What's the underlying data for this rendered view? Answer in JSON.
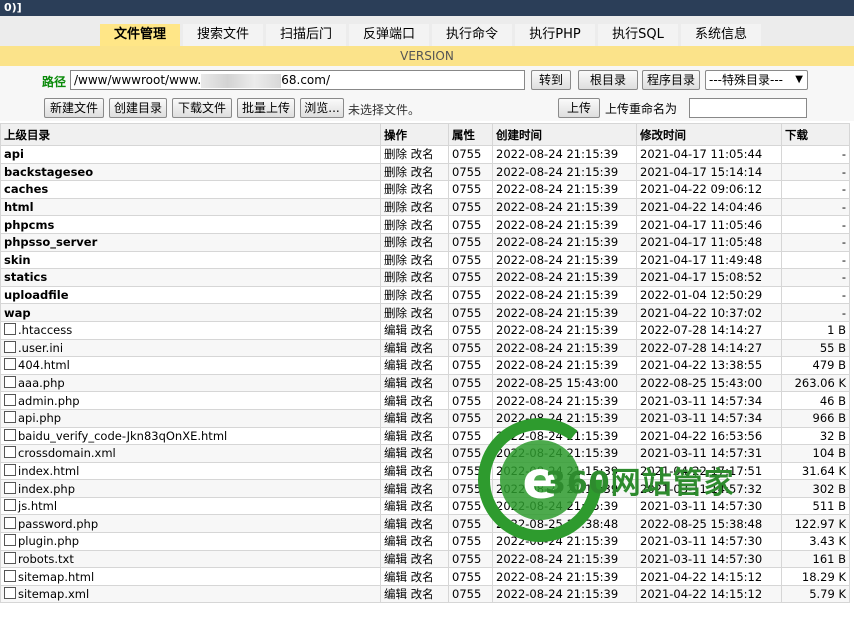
{
  "header": {
    "title": "0)]"
  },
  "tabs": [
    {
      "label": "文件管理",
      "active": true
    },
    {
      "label": "搜索文件"
    },
    {
      "label": "扫描后门"
    },
    {
      "label": "反弹端口"
    },
    {
      "label": "执行命令"
    },
    {
      "label": "执行PHP"
    },
    {
      "label": "执行SQL"
    },
    {
      "label": "系统信息"
    }
  ],
  "version_label": "VERSION",
  "path_bar": {
    "label": "路径",
    "value_prefix": "/www/wwwroot/www.",
    "value_suffix": "68.com/",
    "go_button": "转到",
    "root_button": "根目录",
    "program_button": "程序目录",
    "special_select": "---特殊目录---"
  },
  "upload_bar": {
    "new_file": "新建文件",
    "create_dir": "创建目录",
    "download_file": "下载文件",
    "batch_upload": "批量上传",
    "browse": "浏览...",
    "no_file": "未选择文件。",
    "upload": "上传",
    "rename_label": "上传重命名为"
  },
  "table": {
    "headers": [
      "上级目录",
      "操作",
      "属性",
      "创建时间",
      "修改时间",
      "下载"
    ],
    "dirs": [
      {
        "name": "api",
        "ops": "删除 改名",
        "perm": "0755",
        "created": "2022-08-24 21:15:39",
        "modified": "2021-04-17 11:05:44",
        "size": "-"
      },
      {
        "name": "backstageseo",
        "ops": "删除 改名",
        "perm": "0755",
        "created": "2022-08-24 21:15:39",
        "modified": "2021-04-17 15:14:14",
        "size": "-"
      },
      {
        "name": "caches",
        "ops": "删除 改名",
        "perm": "0755",
        "created": "2022-08-24 21:15:39",
        "modified": "2021-04-22 09:06:12",
        "size": "-"
      },
      {
        "name": "html",
        "ops": "删除 改名",
        "perm": "0755",
        "created": "2022-08-24 21:15:39",
        "modified": "2021-04-22 14:04:46",
        "size": "-"
      },
      {
        "name": "phpcms",
        "ops": "删除 改名",
        "perm": "0755",
        "created": "2022-08-24 21:15:39",
        "modified": "2021-04-17 11:05:46",
        "size": "-"
      },
      {
        "name": "phpsso_server",
        "ops": "删除 改名",
        "perm": "0755",
        "created": "2022-08-24 21:15:39",
        "modified": "2021-04-17 11:05:48",
        "size": "-"
      },
      {
        "name": "skin",
        "ops": "删除 改名",
        "perm": "0755",
        "created": "2022-08-24 21:15:39",
        "modified": "2021-04-17 11:49:48",
        "size": "-"
      },
      {
        "name": "statics",
        "ops": "删除 改名",
        "perm": "0755",
        "created": "2022-08-24 21:15:39",
        "modified": "2021-04-17 15:08:52",
        "size": "-"
      },
      {
        "name": "uploadfile",
        "ops": "删除 改名",
        "perm": "0755",
        "created": "2022-08-24 21:15:39",
        "modified": "2022-01-04 12:50:29",
        "size": "-"
      },
      {
        "name": "wap",
        "ops": "删除 改名",
        "perm": "0755",
        "created": "2022-08-24 21:15:39",
        "modified": "2021-04-22 10:37:02",
        "size": "-"
      }
    ],
    "files": [
      {
        "name": ".htaccess",
        "ops": "编辑 改名",
        "perm": "0755",
        "created": "2022-08-24 21:15:39",
        "modified": "2022-07-28 14:14:27",
        "size": "1 B"
      },
      {
        "name": ".user.ini",
        "ops": "编辑 改名",
        "perm": "0755",
        "created": "2022-08-24 21:15:39",
        "modified": "2022-07-28 14:14:27",
        "size": "55 B"
      },
      {
        "name": "404.html",
        "ops": "编辑 改名",
        "perm": "0755",
        "created": "2022-08-24 21:15:39",
        "modified": "2021-04-22 13:38:55",
        "size": "479 B"
      },
      {
        "name": "aaa.php",
        "ops": "编辑 改名",
        "perm": "0755",
        "created": "2022-08-25 15:43:00",
        "modified": "2022-08-25 15:43:00",
        "size": "263.06 K"
      },
      {
        "name": "admin.php",
        "ops": "编辑 改名",
        "perm": "0755",
        "created": "2022-08-24 21:15:39",
        "modified": "2021-03-11 14:57:34",
        "size": "46 B"
      },
      {
        "name": "api.php",
        "ops": "编辑 改名",
        "perm": "0755",
        "created": "2022-08-24 21:15:39",
        "modified": "2021-03-11 14:57:34",
        "size": "966 B"
      },
      {
        "name": "baidu_verify_code-Jkn83qOnXE.html",
        "ops": "编辑 改名",
        "perm": "0755",
        "created": "2022-08-24 21:15:39",
        "modified": "2021-04-22 16:53:56",
        "size": "32 B"
      },
      {
        "name": "crossdomain.xml",
        "ops": "编辑 改名",
        "perm": "0755",
        "created": "2022-08-24 21:15:39",
        "modified": "2021-03-11 14:57:31",
        "size": "104 B"
      },
      {
        "name": "index.html",
        "ops": "编辑 改名",
        "perm": "0755",
        "created": "2022-08-24 21:15:39",
        "modified": "2021-04-22 17:17:51",
        "size": "31.64 K"
      },
      {
        "name": "index.php",
        "ops": "编辑 改名",
        "perm": "0755",
        "created": "2022-08-24 21:15:39",
        "modified": "2021-03-11 14:57:32",
        "size": "302 B"
      },
      {
        "name": "js.html",
        "ops": "编辑 改名",
        "perm": "0755",
        "created": "2022-08-24 21:15:39",
        "modified": "2021-03-11 14:57:30",
        "size": "511 B"
      },
      {
        "name": "password.php",
        "ops": "编辑 改名",
        "perm": "0755",
        "created": "2022-08-25 15:38:48",
        "modified": "2022-08-25 15:38:48",
        "size": "122.97 K"
      },
      {
        "name": "plugin.php",
        "ops": "编辑 改名",
        "perm": "0755",
        "created": "2022-08-24 21:15:39",
        "modified": "2021-03-11 14:57:30",
        "size": "3.43 K"
      },
      {
        "name": "robots.txt",
        "ops": "编辑 改名",
        "perm": "0755",
        "created": "2022-08-24 21:15:39",
        "modified": "2021-03-11 14:57:30",
        "size": "161 B"
      },
      {
        "name": "sitemap.html",
        "ops": "编辑 改名",
        "perm": "0755",
        "created": "2022-08-24 21:15:39",
        "modified": "2021-04-22 14:15:12",
        "size": "18.29 K"
      },
      {
        "name": "sitemap.xml",
        "ops": "编辑 改名",
        "perm": "0755",
        "created": "2022-08-24 21:15:39",
        "modified": "2021-04-22 14:15:12",
        "size": "5.79 K"
      }
    ]
  },
  "watermark": {
    "text": "360网站管家",
    "color": "#2e8b2e"
  }
}
